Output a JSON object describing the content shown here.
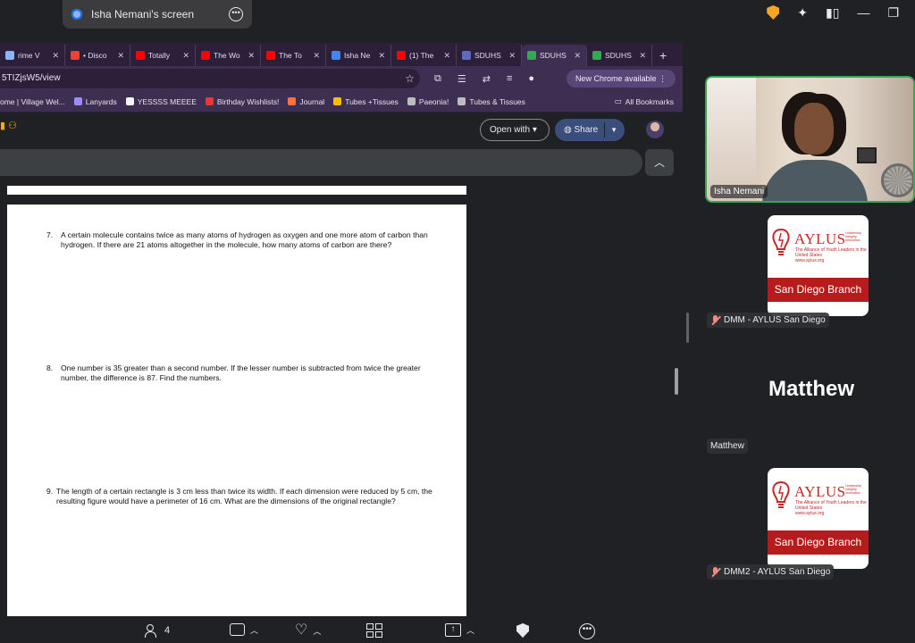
{
  "meet": {
    "presenter_label": "Isha Nemani's screen",
    "participant_count": "4"
  },
  "browser": {
    "tabs": [
      {
        "label": "rime V",
        "color": "#8ab4f8"
      },
      {
        "label": "• Disco",
        "color": "#ea4335"
      },
      {
        "label": "Totally",
        "color": "#ff0000"
      },
      {
        "label": "The Wo",
        "color": "#ff0000"
      },
      {
        "label": "The To",
        "color": "#ff0000"
      },
      {
        "label": "Isha Ne",
        "color": "#4285f4"
      },
      {
        "label": "(1) The",
        "color": "#ff0000"
      },
      {
        "label": "SDUHS",
        "color": "#5c6bc0"
      },
      {
        "label": "SDUHS",
        "color": "#34a853",
        "active": true
      },
      {
        "label": "SDUHS",
        "color": "#34a853"
      }
    ],
    "url": "5TIZjsW5/view",
    "new_chrome_label": "New Chrome available",
    "bookmarks": [
      {
        "label": "ome | Village Wel...",
        "color": "#5f6368"
      },
      {
        "label": "Lanyards",
        "color": "#9c8cff"
      },
      {
        "label": "YESSSS MEEEE",
        "color": "#f5f5f5"
      },
      {
        "label": "Birthday Wishlists!",
        "color": "#e53935"
      },
      {
        "label": "Journal",
        "color": "#ff7043"
      },
      {
        "label": "Tubes +Tissues",
        "color": "#fbbc04"
      },
      {
        "label": "Paeonia!",
        "color": "#bdbdbd"
      },
      {
        "label": "Tubes & Tissues",
        "color": "#bdbdbd"
      }
    ],
    "all_bookmarks_label": "All Bookmarks"
  },
  "viewer": {
    "open_with_label": "Open with",
    "share_label": "Share"
  },
  "document": {
    "questions": [
      {
        "number": "7.",
        "text": "A certain molecule contains twice as many atoms of hydrogen as oxygen and one more atom of carbon than hydrogen.  If there are 21 atoms altogether in the molecule, how many atoms of carbon are there?"
      },
      {
        "number": "8.",
        "text": "One number is 35 greater than a second number.  If the lesser number is subtracted from twice the greater number, the difference is 87.  Find the numbers."
      },
      {
        "number": "9.",
        "text": "The length of a certain rectangle is 3 cm less than twice its width. If each dimension were reduced by 5 cm, the resulting figure would have a perimeter of 16 cm. What are the dimensions of the original rectangle?"
      }
    ]
  },
  "participants": {
    "self_name": "Isha Nemani",
    "tile1_label": "DMM - AYLUS San Diego",
    "big_name": "Matthew",
    "small_name": "Matthew",
    "tile2_label": "DMM2 - AYLUS San Diego",
    "logo": {
      "title": "AYLUS",
      "tagline": [
        "Leadership",
        "Integrity",
        "Innovation"
      ],
      "subtitle": "The Alliance of Youth Leaders in the United States",
      "site": "www.aylus.org",
      "branch": "San Diego Branch"
    }
  }
}
